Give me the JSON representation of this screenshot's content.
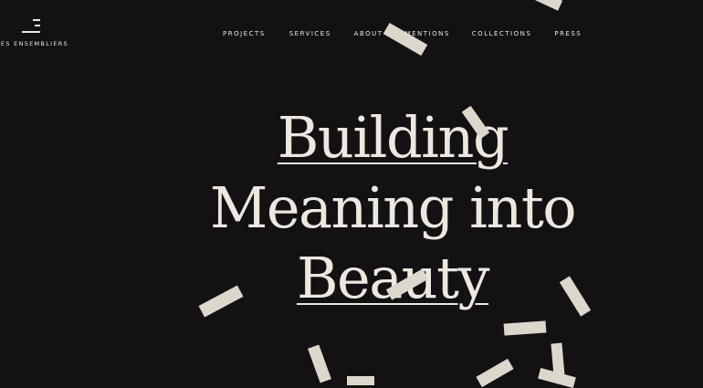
{
  "brand": {
    "name": "LES ENSEMBLIERS"
  },
  "nav": {
    "items": [
      "PROJECTS",
      "SERVICES",
      "ABOUT",
      "MENTIONS",
      "COLLECTIONS",
      "PRESS"
    ]
  },
  "hero": {
    "line1": "Building",
    "line2": "Meaning into",
    "line3": "Beauty"
  },
  "colors": {
    "background": "#131112",
    "text": "#ece8e1",
    "shapes": "#dcd7cd"
  }
}
